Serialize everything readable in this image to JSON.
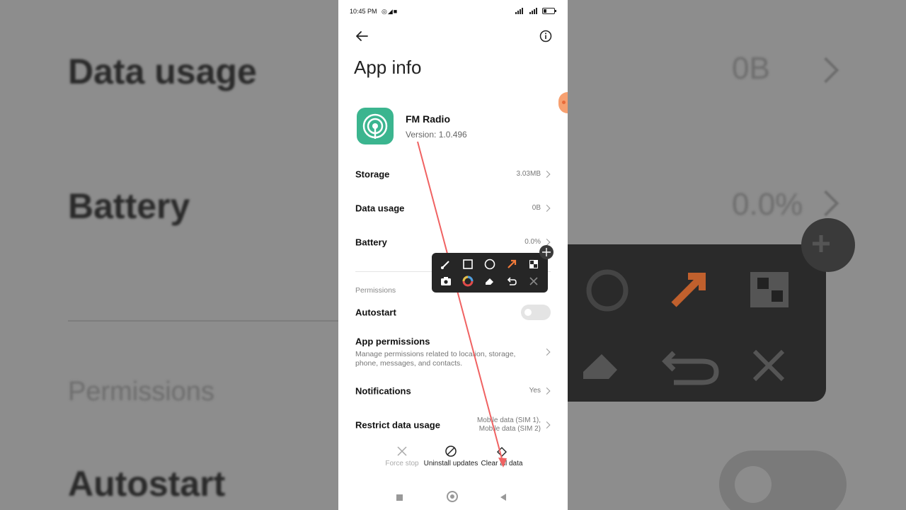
{
  "status_bar": {
    "time": "10:45 PM",
    "icons": [
      "whatsapp-icon",
      "telegram-icon",
      "video-icon"
    ],
    "battery": "battery-icon"
  },
  "header": {
    "title": "App info"
  },
  "app": {
    "name": "FM Radio",
    "version": "Version: 1.0.496",
    "icon_color": "#3bb58f"
  },
  "rows": {
    "storage": {
      "label": "Storage",
      "value": "3.03MB"
    },
    "data_usage": {
      "label": "Data usage",
      "value": "0B"
    },
    "battery": {
      "label": "Battery",
      "value": "0.0%"
    }
  },
  "permissions": {
    "section_title": "Permissions",
    "autostart": {
      "label": "Autostart",
      "enabled": false
    },
    "app_permissions": {
      "label": "App permissions",
      "description": "Manage permissions related to location, storage, phone, messages, and contacts."
    },
    "notifications": {
      "label": "Notifications",
      "value": "Yes"
    },
    "restrict_data": {
      "label": "Restrict data usage",
      "value_line1": "Mobile data (SIM 1),",
      "value_line2": "Mobile data (SIM 2)"
    }
  },
  "actions": {
    "force_stop": "Force stop",
    "uninstall_updates": "Uninstall updates",
    "clear_all_data": "Clear all data"
  },
  "background": {
    "left": {
      "data_usage": "Data usage",
      "battery": "Battery",
      "permissions": "Permissions",
      "autostart": "Autostart"
    },
    "right": {
      "data_usage_value": "0B",
      "battery_value": "0.0%"
    }
  },
  "annotation": {
    "arrow_color": "#f06262"
  }
}
